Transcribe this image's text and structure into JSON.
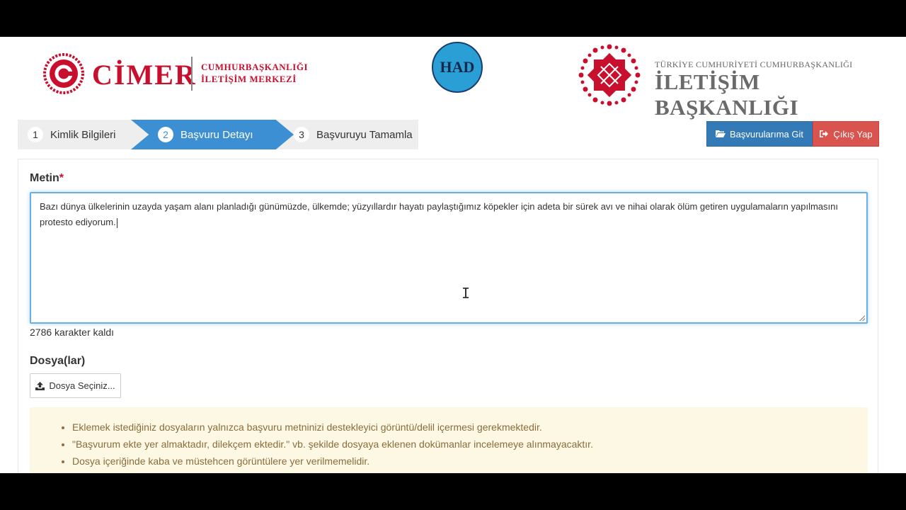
{
  "header": {
    "cimer_title": "CİMER",
    "cimer_sub_line1": "CUMHURBAŞKANLIĞI",
    "cimer_sub_line2": "İLETİŞİM MERKEZİ",
    "had_logo_text": "HAD",
    "ib_top": "TÜRKİYE CUMHURİYETİ CUMHURBAŞKANLIĞI",
    "ib_main": "İLETİŞİM BAŞKANLIĞI"
  },
  "wizard": {
    "steps": [
      {
        "num": "1",
        "label": "Kimlik Bilgileri"
      },
      {
        "num": "2",
        "label": "Başvuru Detayı"
      },
      {
        "num": "3",
        "label": "Başvuruyu Tamamla"
      }
    ],
    "active_step": 2
  },
  "actions": {
    "applications_label": "Başvurularıma Git",
    "logout_label": "Çıkış Yap"
  },
  "form": {
    "metin_label": "Metin",
    "required_mark": "*",
    "metin_value": "Bazı dünya ülkelerinin uzayda yaşam alanı planladığı günümüzde, ülkemde; yüzyıllardır hayatı paylaştığımız köpekler için adeta bir sürek avı ve nihai olarak ölüm getiren uygulamaların yapılmasını protesto ediyorum.",
    "chars_left": "2786 karakter kaldı",
    "files_label": "Dosya(lar)",
    "file_button": "Dosya Seçiniz..."
  },
  "info": {
    "items": [
      "Eklemek istediğiniz dosyaların yalnızca başvuru metninizi destekleyici görüntü/delil içermesi gerekmektedir.",
      "\"Başvurum ekte yer almaktadır, dilekçem ektedir.\" vb. şekilde dosyaya eklenen dokümanlar incelemeye alınmayacaktır.",
      "Dosya içeriğinde kaba ve müstehcen görüntülere yer verilmemelidir."
    ]
  },
  "colors": {
    "brand_red": "#c8102e",
    "active_step": "#3c8fd2",
    "primary_button": "#337ab7",
    "danger_button": "#d9534f",
    "info_bg": "#fcf8e3",
    "info_text": "#8a6d3b"
  }
}
